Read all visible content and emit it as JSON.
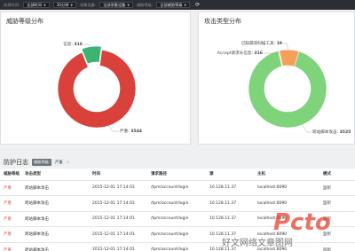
{
  "filters": {
    "items": [
      {
        "label": "选择时间:",
        "value": "全部时间"
      },
      {
        "label": "",
        "value": "30分钟"
      },
      {
        "label": "采集设备:",
        "value": "全部采集设备"
      },
      {
        "label": "威胁等级:",
        "value": "全部威胁等级"
      }
    ]
  },
  "threat_panel": {
    "title": "威胁等级分布",
    "labels": [
      {
        "name": "信息",
        "value": "316"
      },
      {
        "name": "严重",
        "value": "3544"
      }
    ]
  },
  "attack_panel": {
    "title": "攻击类型分布",
    "labels": [
      {
        "name": "已知漏洞扫描工具",
        "value": "19"
      },
      {
        "name": "Accept请求头信息",
        "value": "316"
      },
      {
        "name": "跨站脚本攻击",
        "value": "3525"
      }
    ]
  },
  "chart_data": [
    {
      "type": "pie",
      "title": "威胁等级分布",
      "categories": [
        "信息",
        "严重"
      ],
      "values": [
        316,
        3544
      ],
      "colors": [
        "#3cb371",
        "#d9413b"
      ]
    },
    {
      "type": "pie",
      "title": "攻击类型分布",
      "categories": [
        "已知漏洞扫描工具",
        "Accept请求头信息",
        "跨站脚本攻击"
      ],
      "values": [
        19,
        316,
        3525
      ],
      "colors": [
        "#f0c36d",
        "#f5a05a",
        "#7ed37b"
      ]
    }
  ],
  "log": {
    "title": "防护日志",
    "filter_key": "威胁等级:",
    "filter_value": "严重",
    "filter_close": "×",
    "columns": [
      "威胁等级",
      "攻击类型",
      "时间",
      "请求路径",
      "源",
      "主机",
      "模式"
    ],
    "rows": [
      [
        "严重",
        "跨站脚本攻击",
        "2015-12-01 17:14:01",
        "/tpm/account/login",
        "10.128.11.37",
        "localhost:8090",
        "监听"
      ],
      [
        "严重",
        "跨站脚本攻击",
        "2015-12-01 17:14:01",
        "/tpm/account/login",
        "10.128.11.37",
        "localhost:8090",
        "监听"
      ],
      [
        "严重",
        "跨站脚本攻击",
        "2015-12-01 17:14:01",
        "/tpm/account/login",
        "10.128.11.37",
        "localhost:8090",
        "监听"
      ],
      [
        "严重",
        "跨站脚本攻击",
        "2015-12-01 17:14:01",
        "/tpm/account/login",
        "10.128.11.37",
        "localhost:8090",
        "监听"
      ],
      [
        "严重",
        "跨站脚本攻击",
        "2015-12-01 17:14:01",
        "/tpm/account/login",
        "10.128.11.37",
        "localhost:8090",
        "监听"
      ]
    ]
  },
  "watermark": {
    "text": "好文网络文章图网",
    "logo": "Pcto"
  }
}
